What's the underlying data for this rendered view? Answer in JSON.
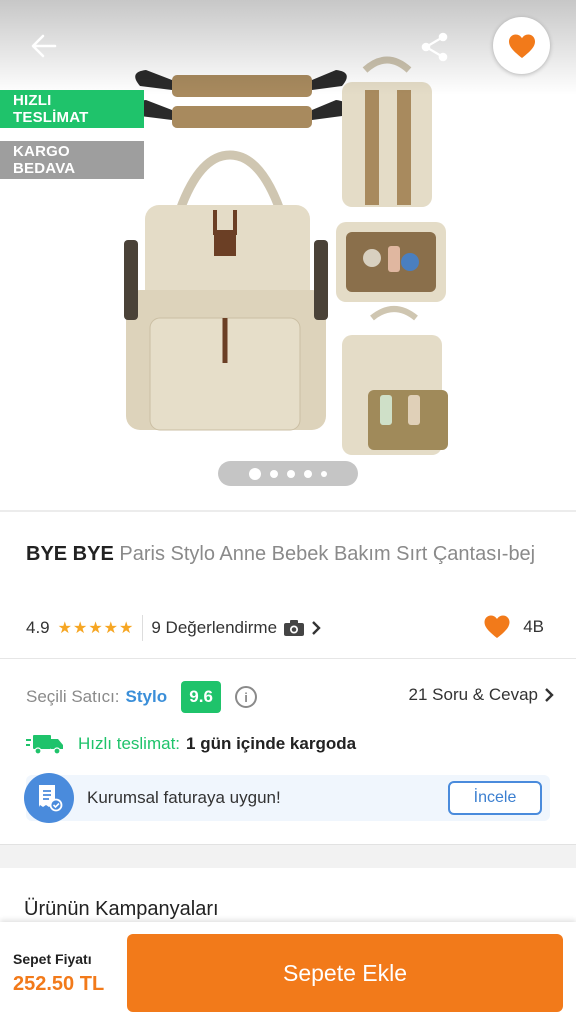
{
  "header": {
    "back_icon": "arrow-left-icon",
    "share_icon": "share-icon",
    "favorite_icon": "heart-icon"
  },
  "badges": {
    "fast_delivery": "HIZLI TESLİMAT",
    "free_shipping": "KARGO BEDAVA"
  },
  "gallery": {
    "image_count": 5,
    "active_index": 0
  },
  "product": {
    "brand": "BYE BYE",
    "name": "Paris Stylo Anne Bebek Bakım Sırt Çantası-bej",
    "rating": "4.9",
    "stars": "★★★★★",
    "reviews": "9 Değerlendirme",
    "camera_icon": "camera-icon",
    "favorites_count": "4B"
  },
  "seller": {
    "label": "Seçili Satıcı:",
    "name": "Stylo",
    "score": "9.6",
    "info_symbol": "i",
    "qa_link": "21 Soru & Cevap"
  },
  "delivery": {
    "label": "Hızlı teslimat:",
    "value": "1 gün içinde kargoda"
  },
  "invoice": {
    "text": "Kurumsal faturaya uygun!",
    "button": "İncele"
  },
  "campaigns": {
    "title": "Ürünün Kampanyaları"
  },
  "bottom_bar": {
    "price_label": "Sepet Fiyatı",
    "price_value": "252.50 TL",
    "add_to_cart": "Sepete Ekle"
  },
  "colors": {
    "brand_orange": "#f27a1a",
    "green": "#1fc36b",
    "blue": "#3b8fd9",
    "star": "#f6a623"
  }
}
